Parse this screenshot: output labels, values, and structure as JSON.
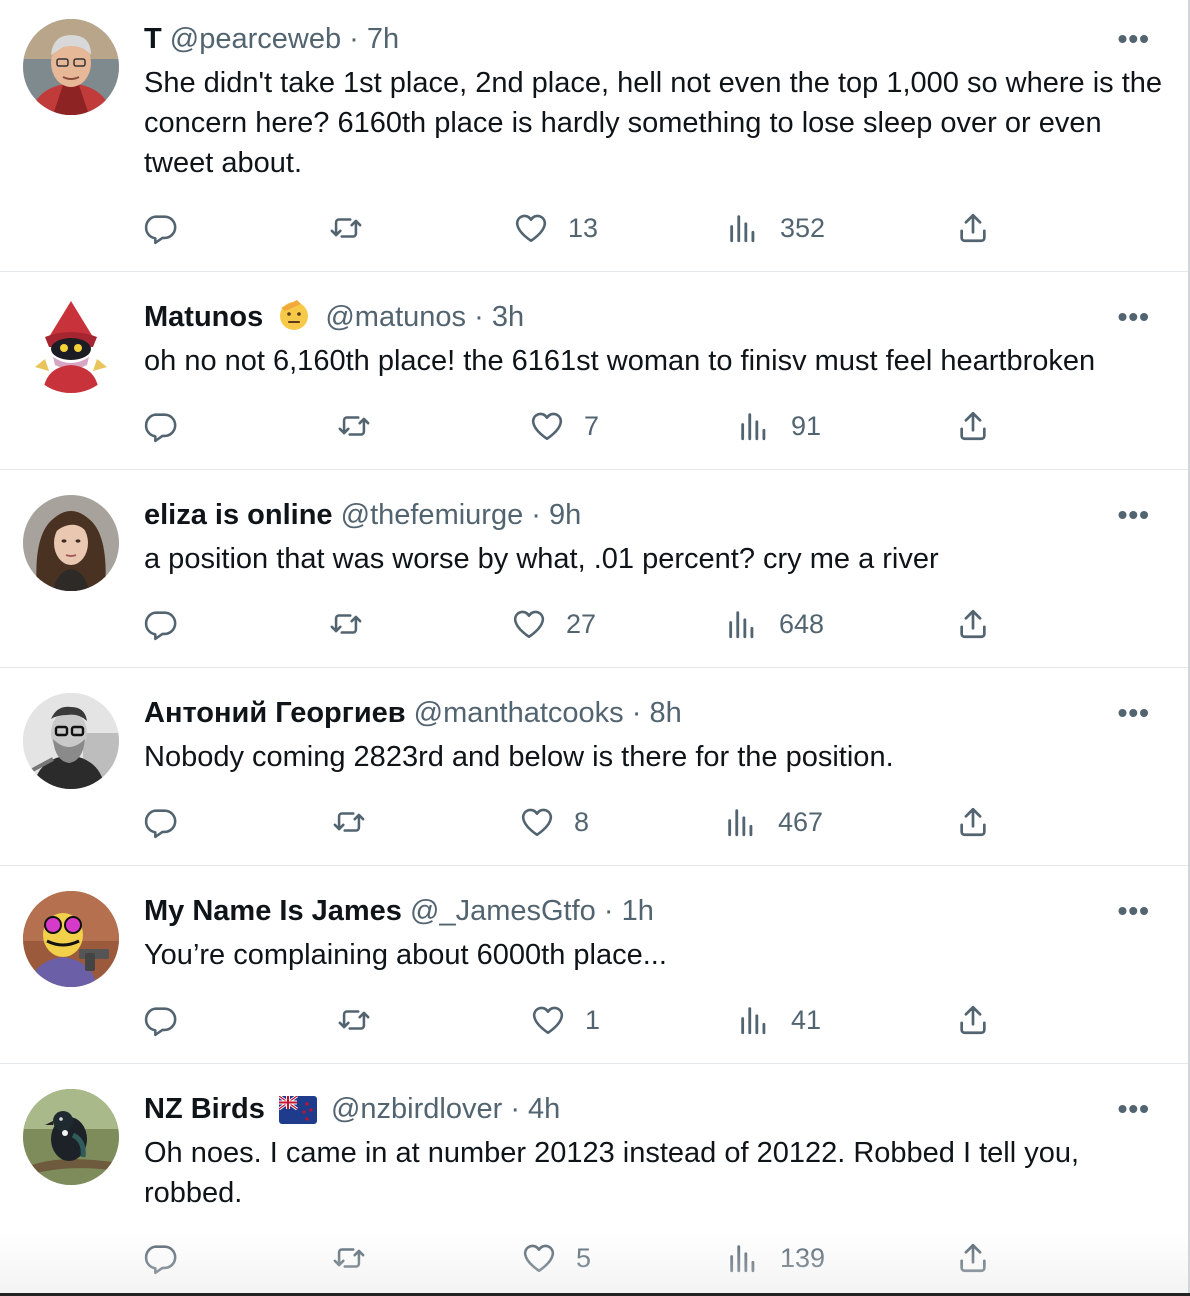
{
  "tweets": [
    {
      "name": "T",
      "handle": "@pearceweb",
      "separator": "·",
      "time": "7h",
      "text": "She didn't take 1st place, 2nd place, hell not even the top 1,000 so where is the concern here? 6160th place is hardly something to lose sleep over or even tweet about.",
      "likes": "13",
      "views": "352",
      "badge": "",
      "avatar": "man-glasses-avatar"
    },
    {
      "name": "Matunos",
      "handle": "@matunos",
      "separator": "·",
      "time": "3h",
      "text": "oh no not 6,160th place! the 6161st woman to finisv must feel heartbroken",
      "likes": "7",
      "views": "91",
      "badge": "saluting-face-emoji",
      "avatar": "orko-cartoon-avatar"
    },
    {
      "name": "eliza is online",
      "handle": "@thefemiurge",
      "separator": "·",
      "time": "9h",
      "text": "a position that was worse by what, .01 percent? cry me a river",
      "likes": "27",
      "views": "648",
      "badge": "",
      "avatar": "woman-portrait-avatar"
    },
    {
      "name": "Антоний Георгиев",
      "handle": "@manthatcooks",
      "separator": "·",
      "time": "8h",
      "text": "Nobody coming 2823rd and below is there for the position.",
      "likes": "8",
      "views": "467",
      "badge": "",
      "avatar": "bearded-man-bw-avatar"
    },
    {
      "name": "My Name Is James",
      "handle": "@_JamesGtfo",
      "separator": "·",
      "time": "1h",
      "text": "You’re complaining about 6000th place...",
      "likes": "1",
      "views": "41",
      "badge": "",
      "avatar": "cartoon-gun-avatar"
    },
    {
      "name": "NZ Birds",
      "handle": "@nzbirdlover",
      "separator": "·",
      "time": "4h",
      "text": "Oh noes. I came in at number 20123 instead of 20122. Robbed I tell you, robbed.",
      "likes": "5",
      "views": "139",
      "badge": "new-zealand-flag-emoji",
      "avatar": "tui-bird-avatar"
    }
  ],
  "more_label": "•••",
  "icons": {
    "reply": "reply-icon",
    "retweet": "retweet-icon",
    "like": "heart-icon",
    "views": "views-chart-icon",
    "share": "share-icon"
  },
  "colors": {
    "text": "#0f1419",
    "secondary": "#536471",
    "divider": "#e6e9ec"
  }
}
